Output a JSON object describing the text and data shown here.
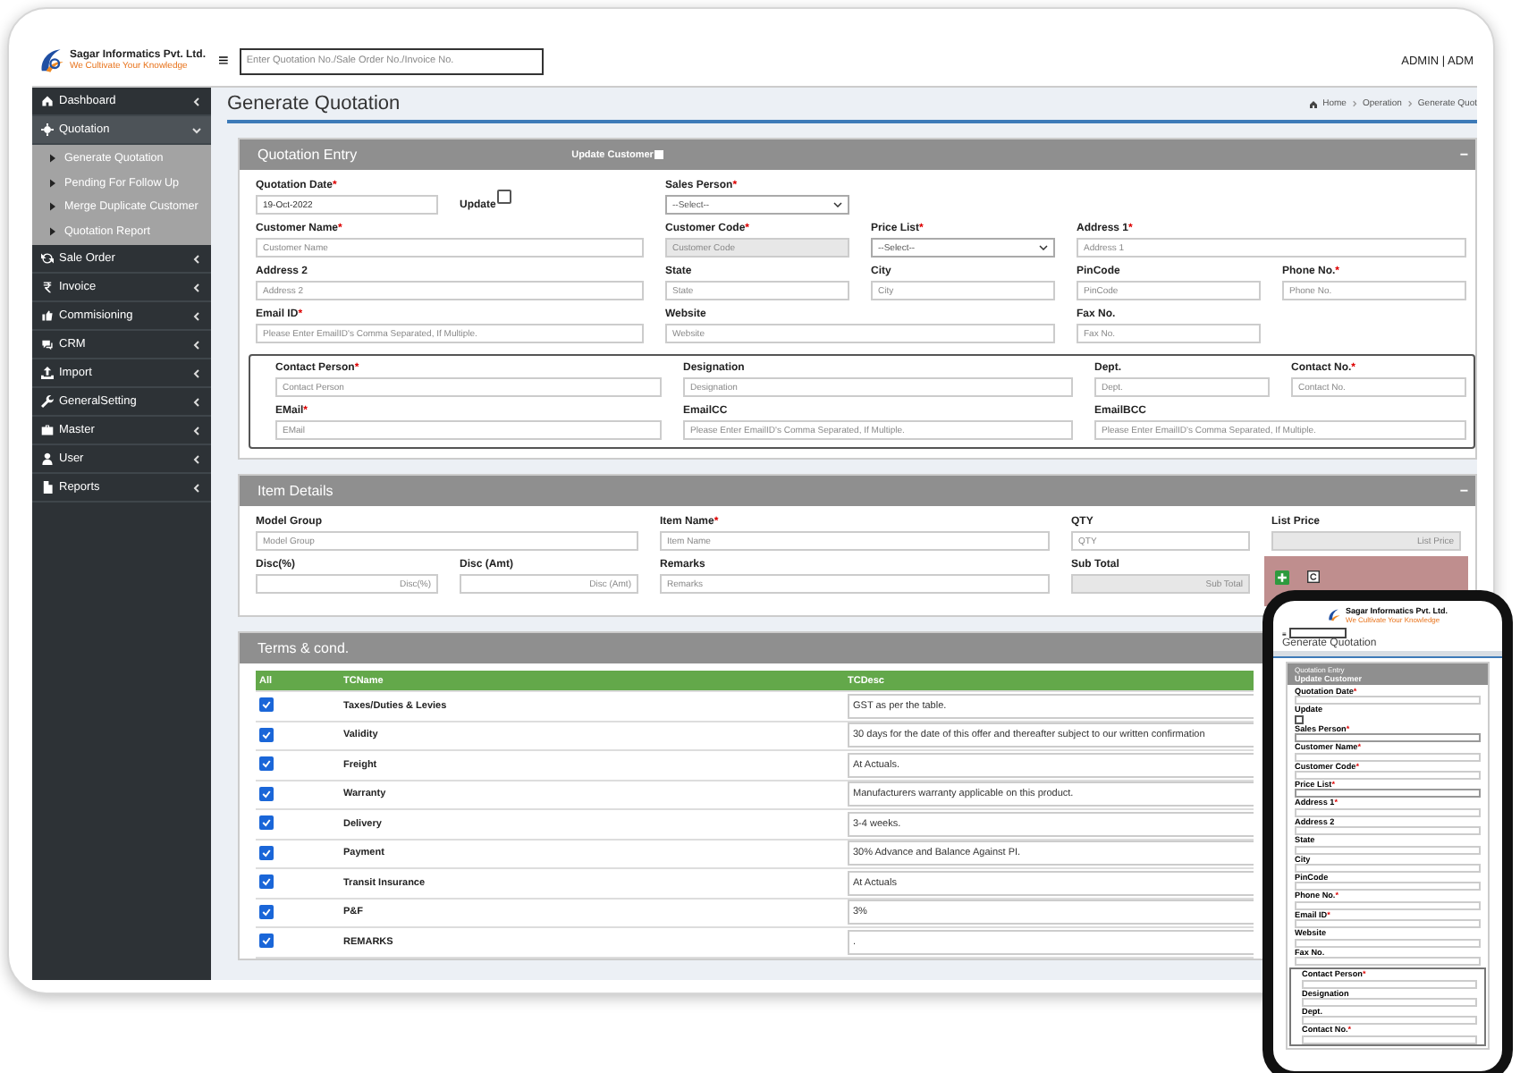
{
  "header": {
    "company": "Sagar Informatics Pvt. Ltd.",
    "tagline": "We Cultivate Your Knowledge",
    "menu_icon": "≡",
    "search": {
      "placeholder": "Enter Quotation No./Sale Order No./Invoice No."
    },
    "user": "ADMIN | ADM"
  },
  "sidebar": {
    "items": [
      {
        "label": "Dashboard",
        "expanded": false
      },
      {
        "label": "Quotation",
        "expanded": true,
        "children": [
          {
            "label": "Generate Quotation"
          },
          {
            "label": "Pending For Follow Up"
          },
          {
            "label": "Merge Duplicate Customer"
          },
          {
            "label": "Quotation Report"
          }
        ]
      },
      {
        "label": "Sale Order",
        "expanded": false
      },
      {
        "label": "Invoice",
        "expanded": false
      },
      {
        "label": "Commisioning",
        "expanded": false
      },
      {
        "label": "CRM",
        "expanded": false
      },
      {
        "label": "Import",
        "expanded": false
      },
      {
        "label": "GeneralSetting",
        "expanded": false
      },
      {
        "label": "Master",
        "expanded": false
      },
      {
        "label": "User",
        "expanded": false
      },
      {
        "label": "Reports",
        "expanded": false
      }
    ]
  },
  "page_title": "Generate Quotation",
  "breadcrumb": [
    "Home",
    "Operation",
    "Generate Quot"
  ],
  "quotation_entry": {
    "title": "Quotation Entry",
    "update_customer": {
      "label": "Update Customer",
      "checked": false
    },
    "collapse": "−",
    "fields": [
      {
        "label": "Quotation Date",
        "mark": "*",
        "kind": "text",
        "value": "19-Oct-2022",
        "disabled": false
      },
      {
        "label": "Update",
        "kind": "checkbox",
        "checked": false
      },
      {
        "label": "Sales Person",
        "mark": "*",
        "kind": "select",
        "placeholder": "--Select--"
      },
      {
        "label": "Customer Name",
        "mark": "*",
        "kind": "text",
        "placeholder": "Customer Name",
        "disabled": false
      },
      {
        "label": "Customer Code",
        "mark": "*",
        "kind": "text",
        "placeholder": "Customer Code",
        "disabled": true
      },
      {
        "label": "Price List",
        "mark": "*",
        "kind": "select",
        "placeholder": "--Select--"
      },
      {
        "label": "Address 1",
        "mark": "*",
        "kind": "text",
        "placeholder": "Address 1",
        "disabled": false
      },
      {
        "label": "Address 2",
        "kind": "text",
        "placeholder": "Address 2",
        "disabled": false
      },
      {
        "label": "State",
        "kind": "text",
        "placeholder": "State",
        "disabled": false
      },
      {
        "label": "City",
        "kind": "text",
        "placeholder": "City",
        "disabled": false
      },
      {
        "label": "PinCode",
        "kind": "text",
        "placeholder": "PinCode",
        "disabled": false
      },
      {
        "label": "Phone No.",
        "mark": "*",
        "kind": "text",
        "placeholder": "Phone No.",
        "disabled": false
      },
      {
        "label": "Email ID",
        "mark": "*",
        "kind": "text",
        "placeholder": "Please Enter EmailID's Comma Separated, If Multiple.",
        "disabled": false
      },
      {
        "label": "Website",
        "kind": "text",
        "placeholder": "Website",
        "disabled": false
      },
      {
        "label": "Fax No.",
        "kind": "text",
        "placeholder": "Fax No.",
        "disabled": false
      }
    ],
    "contact_fields": [
      {
        "label": "Contact Person",
        "mark": "*",
        "kind": "text",
        "placeholder": "Contact Person",
        "disabled": false
      },
      {
        "label": "Designation",
        "kind": "text",
        "placeholder": "Designation",
        "disabled": false
      },
      {
        "label": "Dept.",
        "kind": "text",
        "placeholder": "Dept.",
        "disabled": false
      },
      {
        "label": "Contact No.",
        "mark": "*",
        "kind": "text",
        "placeholder": "Contact No.",
        "disabled": false
      },
      {
        "label": "EMail",
        "mark": "*",
        "kind": "text",
        "placeholder": "EMail",
        "disabled": false
      },
      {
        "label": "EmailCC",
        "kind": "text",
        "placeholder": "Please Enter EmailID's Comma Separated, If Multiple.",
        "disabled": false
      },
      {
        "label": "EmailBCC",
        "kind": "text",
        "placeholder": "Please Enter EmailID's Comma Separated, If Multiple.",
        "disabled": false
      }
    ]
  },
  "item_details": {
    "title": "Item Details",
    "collapse": "−",
    "fields": [
      {
        "label": "Model Group",
        "kind": "text",
        "placeholder": "Model Group",
        "disabled": false
      },
      {
        "label": "Item Name",
        "mark": "*",
        "kind": "text",
        "placeholder": "Item Name",
        "disabled": false
      },
      {
        "label": "QTY",
        "kind": "text",
        "placeholder": "QTY",
        "disabled": false
      },
      {
        "label": "List Price",
        "kind": "text",
        "placeholder": "List Price",
        "disabled": true
      },
      {
        "label": "Disc(%)",
        "kind": "text",
        "placeholder": "Disc(%)",
        "disabled": false
      },
      {
        "label": "Disc (Amt)",
        "kind": "text",
        "placeholder": "Disc (Amt)",
        "disabled": false
      },
      {
        "label": "Remarks",
        "kind": "text",
        "placeholder": "Remarks",
        "disabled": false
      },
      {
        "label": "Sub Total",
        "kind": "text",
        "placeholder": "Sub Total",
        "disabled": true
      }
    ]
  },
  "terms": {
    "title": "Terms & cond.",
    "columns": [
      "All",
      "TCName",
      "TCDesc"
    ],
    "rows": [
      {
        "checked": true,
        "name": "Taxes/Duties & Levies",
        "desc": "GST as per the table."
      },
      {
        "checked": true,
        "name": "Validity",
        "desc": "30 days for the date of this offer and thereafter subject to our written confirmation"
      },
      {
        "checked": true,
        "name": "Freight",
        "desc": "At Actuals."
      },
      {
        "checked": true,
        "name": "Warranty",
        "desc": "Manufacturers warranty applicable on this product."
      },
      {
        "checked": true,
        "name": "Delivery",
        "desc": "3-4 weeks."
      },
      {
        "checked": true,
        "name": "Payment",
        "desc": "30% Advance and Balance Against PI."
      },
      {
        "checked": true,
        "name": "Transit Insurance",
        "desc": "At Actuals"
      },
      {
        "checked": true,
        "name": "P&F",
        "desc": "3%"
      },
      {
        "checked": true,
        "name": "REMARKS",
        "desc": "."
      }
    ]
  },
  "phone": {
    "company": "Sagar Informatics Pvt. Ltd.",
    "tagline": "We Cultivate Your Knowledge",
    "page_title": "Generate Quotation",
    "panel_title": "Quotation Entry",
    "update_customer": "Update Customer",
    "fields": [
      {
        "label": "Quotation Date",
        "mark": "*",
        "kind": "text"
      },
      {
        "label": "Update",
        "kind": "checkbox",
        "checked": false
      },
      {
        "label": "Sales Person",
        "mark": "*",
        "kind": "select"
      },
      {
        "label": "Customer Name",
        "mark": "*",
        "kind": "text"
      },
      {
        "label": "Customer Code",
        "mark": "*",
        "kind": "text"
      },
      {
        "label": "Price List",
        "mark": "*",
        "kind": "select"
      },
      {
        "label": "Address 1",
        "mark": "*",
        "kind": "text"
      },
      {
        "label": "Address 2",
        "kind": "text"
      },
      {
        "label": "State",
        "kind": "text"
      },
      {
        "label": "City",
        "kind": "text"
      },
      {
        "label": "PinCode",
        "kind": "text"
      },
      {
        "label": "Phone No.",
        "mark": "*",
        "kind": "text"
      },
      {
        "label": "Email ID",
        "mark": "*",
        "kind": "text"
      },
      {
        "label": "Website",
        "kind": "text"
      },
      {
        "label": "Fax No.",
        "kind": "text"
      }
    ],
    "contact_fields": [
      {
        "label": "Contact Person",
        "mark": "*",
        "kind": "text"
      },
      {
        "label": "Designation",
        "kind": "text"
      },
      {
        "label": "Dept.",
        "kind": "text"
      },
      {
        "label": "Contact No.",
        "mark": "*",
        "kind": "text"
      }
    ]
  }
}
